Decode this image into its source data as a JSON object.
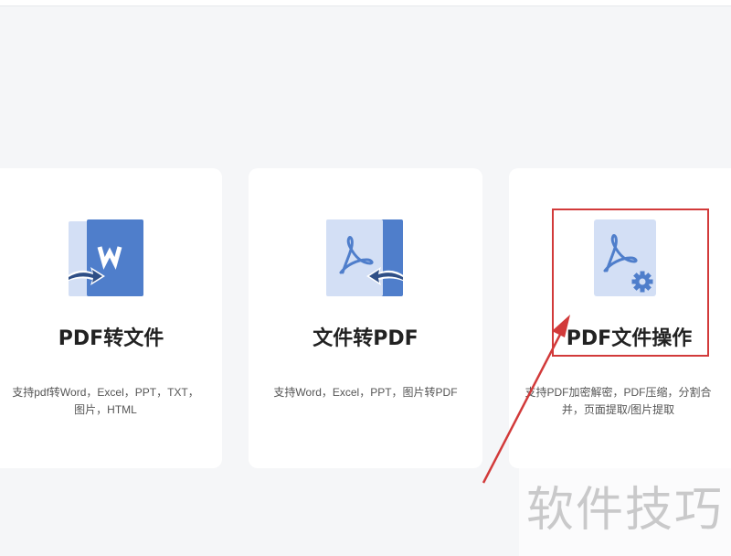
{
  "cards": [
    {
      "title": "PDF转文件",
      "desc_line1": "支持pdf转Word，Excel，PPT，TXT，",
      "desc_line2": "图片，HTML",
      "icon": "pdf-to-word-icon"
    },
    {
      "title": "文件转PDF",
      "desc_line1": "支持Word，Excel，PPT，图片转PDF",
      "icon": "file-to-pdf-icon"
    },
    {
      "title": "PDF文件操作",
      "desc_line1": "支持PDF加密解密，PDF压缩，分割合",
      "desc_line2": "并，页面提取/图片提取",
      "icon": "pdf-settings-icon"
    }
  ],
  "watermark": "软件技巧",
  "colors": {
    "icon_light": "#d3dff5",
    "icon_dark": "#4f7ecb",
    "annotation": "#d23a3a"
  }
}
